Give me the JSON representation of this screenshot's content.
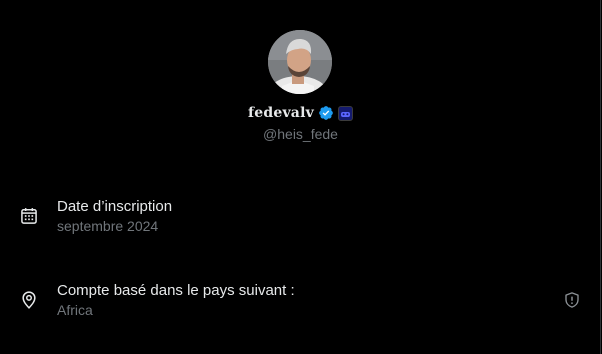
{
  "profile": {
    "display_name": "fedevalv",
    "handle": "@heis_fede",
    "avatar_alt": "Profile photo",
    "verified_color": "#1d9bf0"
  },
  "about": {
    "joined": {
      "label": "Date d’inscription",
      "value": "septembre 2024",
      "icon": "calendar-icon"
    },
    "country": {
      "label": "Compte basé dans le pays suivant :",
      "value": "Africa",
      "icon": "location-pin-icon",
      "trailing_icon": "shield-icon"
    }
  },
  "colors": {
    "background": "#000000",
    "primary_text": "#e7e9ea",
    "secondary_text": "#71767b"
  }
}
